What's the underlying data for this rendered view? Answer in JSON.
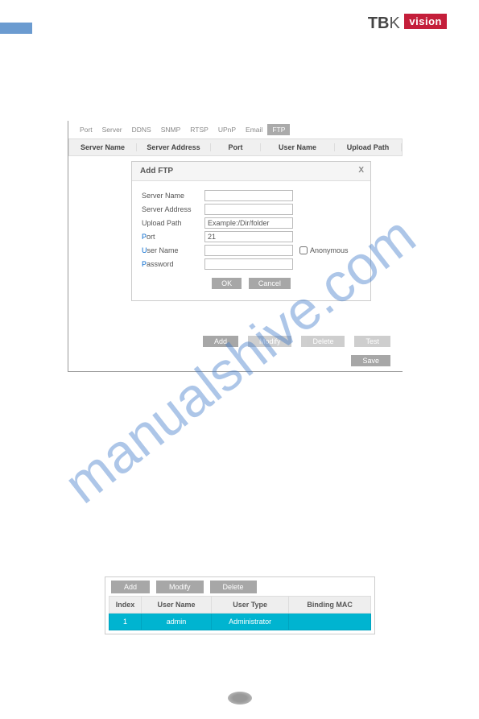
{
  "brand": {
    "pre": "TB",
    "k": "K",
    "sub": "VISION",
    "badge": "vision"
  },
  "tabs": [
    "Port",
    "Server",
    "DDNS",
    "SNMP",
    "RTSP",
    "UPnP",
    "Email",
    "FTP"
  ],
  "table_headers": {
    "c1": "Server Name",
    "c2": "Server Address",
    "c3": "Port",
    "c4": "User Name",
    "c5": "Upload Path"
  },
  "dialog": {
    "title": "Add FTP",
    "fields": {
      "server_name": {
        "label": "Server Name",
        "value": ""
      },
      "server_address": {
        "label": "Server Address",
        "value": ""
      },
      "upload_path": {
        "label": "Upload Path",
        "value": "Example:/Dir/folder"
      },
      "port": {
        "label_pre": "P",
        "label_rest": "ort",
        "value": "21"
      },
      "user_name": {
        "label_pre": "U",
        "label_rest": "ser Name",
        "value": ""
      },
      "password": {
        "label_pre": "P",
        "label_rest": "assword",
        "value": ""
      }
    },
    "anonymous": "Anonymous",
    "ok": "OK",
    "cancel": "Cancel"
  },
  "actions": {
    "add": "Add",
    "modify": "Modify",
    "delete": "Delete",
    "test": "Test",
    "save": "Save"
  },
  "users": {
    "buttons": {
      "add": "Add",
      "modify": "Modify",
      "delete": "Delete"
    },
    "headers": {
      "index": "Index",
      "user_name": "User Name",
      "user_type": "User Type",
      "binding": "Binding MAC"
    },
    "rows": [
      {
        "index": "1",
        "user_name": "admin",
        "user_type": "Administrator",
        "binding": ""
      }
    ]
  },
  "watermark": "manualshive.com"
}
